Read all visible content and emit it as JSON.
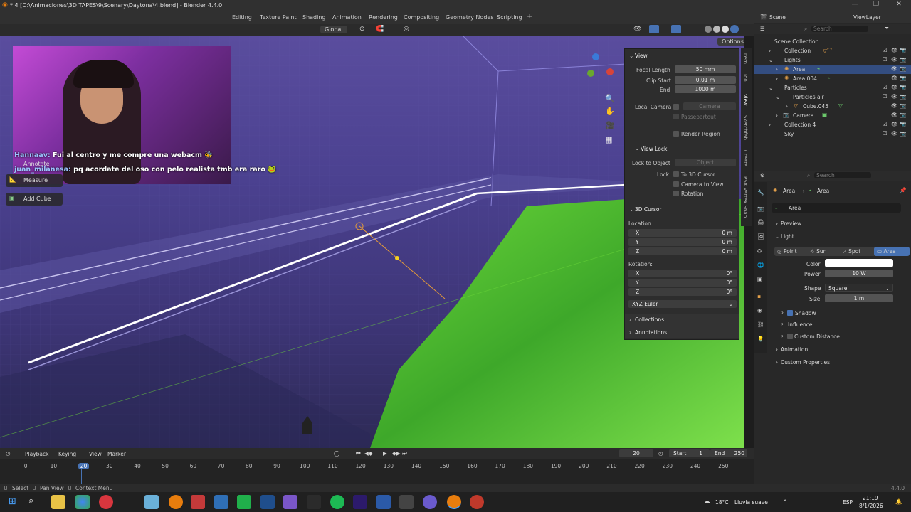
{
  "window": {
    "title": "* 4 [D:\\Animaciones\\3D TAPES\\9\\Scenary\\Daytona\\4.blend] - Blender 4.4.0",
    "min": "—",
    "max": "❐",
    "close": "✕"
  },
  "workspaces": [
    "Editing",
    "Texture Paint",
    "Shading",
    "Animation",
    "Rendering",
    "Compositing",
    "Geometry Nodes",
    "Scripting",
    "+"
  ],
  "header": {
    "orientation": "Global",
    "options": "Options"
  },
  "chat": [
    {
      "user": "Hannaav:",
      "msg": "Fui al centro y me compre una webacm 🐝"
    },
    {
      "user": "juan_milanesa:",
      "msg": "pq acordate del oso con pelo realista tmb era raro 🐸"
    }
  ],
  "tools": [
    "Annotate",
    "Measure",
    "Add Cube"
  ],
  "npanel": {
    "view_title": "View",
    "focal_label": "Focal Length",
    "focal": "50 mm",
    "clipstart_label": "Clip Start",
    "clipstart": "0.01 m",
    "end_label": "End",
    "end": "1000 m",
    "localcam_label": "Local Camera",
    "camera_placeholder": "Camera",
    "passepartout": "Passepartout",
    "render_region": "Render Region",
    "viewlock_title": "View Lock",
    "lockobj_label": "Lock to Object",
    "object_placeholder": "Object",
    "lock_label": "Lock",
    "to3d": "To 3D Cursor",
    "cam2view": "Camera to View",
    "rotation": "Rotation",
    "cursor_title": "3D Cursor",
    "location": "Location:",
    "x": "X",
    "y": "Y",
    "z": "Z",
    "locx": "0 m",
    "locy": "0 m",
    "locz": "0 m",
    "rotation_label": "Rotation:",
    "rotx": "0°",
    "roty": "0°",
    "rotz": "0°",
    "euler": "XYZ Euler",
    "collections": "Collections",
    "annotations": "Annotations"
  },
  "vtabs": [
    "Item",
    "Tool",
    "View",
    "Sketchfab",
    "Create",
    "PSX Vertex Snap"
  ],
  "outliner": {
    "scene": "Scene",
    "viewlayer": "ViewLayer",
    "search": "Search",
    "items": [
      {
        "label": "Scene Collection"
      },
      {
        "label": "Collection"
      },
      {
        "label": "Lights"
      },
      {
        "label": "Area"
      },
      {
        "label": "Area.004"
      },
      {
        "label": "Particles"
      },
      {
        "label": "Particles air"
      },
      {
        "label": "Cube.045"
      },
      {
        "label": "Camera"
      },
      {
        "label": "Collection 4"
      },
      {
        "label": "Sky"
      }
    ]
  },
  "properties": {
    "search": "Search",
    "breadcrumb_a": "Area",
    "breadcrumb_b": "Area",
    "datablock": "Area",
    "preview": "Preview",
    "light": "Light",
    "types": [
      "Point",
      "Sun",
      "Spot",
      "Area"
    ],
    "color_label": "Color",
    "power_label": "Power",
    "power": "10 W",
    "shape_label": "Shape",
    "shape": "Square",
    "size_label": "Size",
    "size": "1 m",
    "shadow": "Shadow",
    "influence": "Influence",
    "custom_distance": "Custom Distance",
    "animation": "Animation",
    "custom_props": "Custom Properties",
    "light_color": "#ffffff"
  },
  "timeline": {
    "menus": [
      "Playback",
      "Keying",
      "View",
      "Marker"
    ],
    "current": "20",
    "start_label": "Start",
    "start": "1",
    "end_label": "End",
    "end": "250",
    "ticks": [
      "0",
      "10",
      "20",
      "30",
      "40",
      "50",
      "60",
      "70",
      "80",
      "90",
      "100",
      "110",
      "120",
      "130",
      "140",
      "150",
      "160",
      "170",
      "180",
      "190",
      "200",
      "210",
      "220",
      "230",
      "240",
      "250"
    ]
  },
  "status": {
    "select": "Select",
    "pan": "Pan View",
    "context": "Context Menu",
    "version": "4.4.0"
  },
  "taskbar": {
    "weather": "18°C",
    "weather_desc": "Lluvia suave",
    "lang": "ESP",
    "time": "21:19",
    "date": "8/1/2026"
  }
}
